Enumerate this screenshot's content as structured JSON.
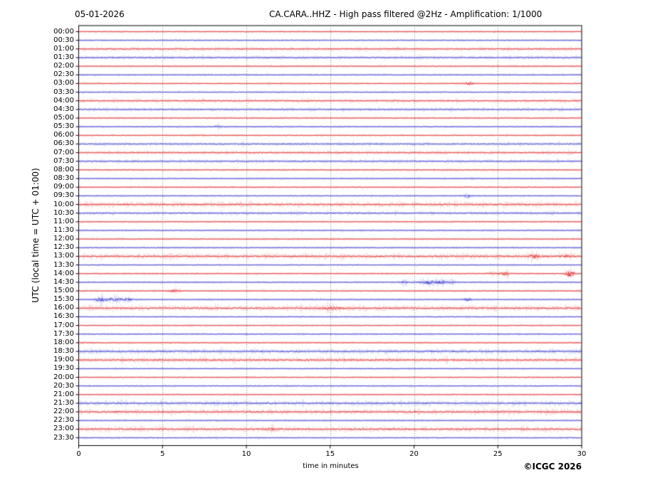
{
  "footer": {
    "copyright": "©ICGC 2026"
  },
  "colors": {
    "trace_red": "#e02222",
    "trace_blue": "#3333cc",
    "grid": "#555555",
    "frame": "#000000"
  },
  "chart_data": {
    "type": "line",
    "variant": "helicorder-seismogram",
    "date": "05-01-2026",
    "title": "CA.CARA..HHZ - High pass filtered @2Hz - Amplification: 1/1000",
    "xlabel": "time in minutes",
    "ylabel": "UTC (local time = UTC + 01:00)",
    "xlim": [
      0,
      30
    ],
    "x_ticks": [
      0,
      5,
      10,
      15,
      20,
      25,
      30
    ],
    "grid": "vertical-dotted-every-5-min",
    "row_minutes": 30,
    "row_color_rule": "rows starting at :00 are red, rows starting at :30 are blue",
    "rows": [
      {
        "label": "00:00",
        "color": "red",
        "noise": "low",
        "events": []
      },
      {
        "label": "00:30",
        "color": "blue",
        "noise": "low",
        "events": []
      },
      {
        "label": "01:00",
        "color": "red",
        "noise": "medium",
        "events": []
      },
      {
        "label": "01:30",
        "color": "blue",
        "noise": "medium",
        "events": []
      },
      {
        "label": "02:00",
        "color": "red",
        "noise": "low",
        "events": []
      },
      {
        "label": "02:30",
        "color": "blue",
        "noise": "low",
        "events": []
      },
      {
        "label": "03:00",
        "color": "red",
        "noise": "low",
        "events": [
          {
            "t": 23.3,
            "amp": 2.0,
            "sigma": 0.18
          }
        ]
      },
      {
        "label": "03:30",
        "color": "blue",
        "noise": "low",
        "events": []
      },
      {
        "label": "04:00",
        "color": "red",
        "noise": "medium",
        "events": []
      },
      {
        "label": "04:30",
        "color": "blue",
        "noise": "medium",
        "events": []
      },
      {
        "label": "05:00",
        "color": "red",
        "noise": "low",
        "events": []
      },
      {
        "label": "05:30",
        "color": "blue",
        "noise": "low",
        "events": [
          {
            "t": 8.3,
            "amp": 1.2,
            "sigma": 0.2
          }
        ]
      },
      {
        "label": "06:00",
        "color": "red",
        "noise": "low",
        "events": []
      },
      {
        "label": "06:30",
        "color": "blue",
        "noise": "medium",
        "events": []
      },
      {
        "label": "07:00",
        "color": "red",
        "noise": "medium",
        "events": []
      },
      {
        "label": "07:30",
        "color": "blue",
        "noise": "medium",
        "events": []
      },
      {
        "label": "08:00",
        "color": "red",
        "noise": "low",
        "events": []
      },
      {
        "label": "08:30",
        "color": "blue",
        "noise": "low",
        "events": []
      },
      {
        "label": "09:00",
        "color": "red",
        "noise": "low",
        "events": []
      },
      {
        "label": "09:30",
        "color": "blue",
        "noise": "low",
        "events": [
          {
            "t": 23.2,
            "amp": 2.4,
            "sigma": 0.12
          }
        ]
      },
      {
        "label": "10:00",
        "color": "red",
        "noise": "high",
        "events": []
      },
      {
        "label": "10:30",
        "color": "blue",
        "noise": "medium",
        "events": []
      },
      {
        "label": "11:00",
        "color": "red",
        "noise": "low",
        "events": []
      },
      {
        "label": "11:30",
        "color": "blue",
        "noise": "low",
        "events": []
      },
      {
        "label": "12:00",
        "color": "red",
        "noise": "low",
        "events": []
      },
      {
        "label": "12:30",
        "color": "blue",
        "noise": "low",
        "events": []
      },
      {
        "label": "13:00",
        "color": "red",
        "noise": "high",
        "events": [
          {
            "t": 27.2,
            "amp": 2.0,
            "sigma": 0.25
          },
          {
            "t": 29.1,
            "amp": 1.2,
            "sigma": 0.2
          }
        ]
      },
      {
        "label": "13:30",
        "color": "blue",
        "noise": "low",
        "events": []
      },
      {
        "label": "14:00",
        "color": "red",
        "noise": "low",
        "events": [
          {
            "t": 24.9,
            "amp": 1.3,
            "sigma": 0.4
          },
          {
            "t": 25.5,
            "amp": 1.8,
            "sigma": 0.15
          },
          {
            "t": 29.3,
            "amp": 4.5,
            "sigma": 0.18
          }
        ]
      },
      {
        "label": "14:30",
        "color": "blue",
        "noise": "low",
        "events": [
          {
            "t": 19.4,
            "amp": 1.6,
            "sigma": 0.15
          },
          {
            "t": 20.9,
            "amp": 2.4,
            "sigma": 0.4
          },
          {
            "t": 21.7,
            "amp": 2.2,
            "sigma": 0.25
          },
          {
            "t": 22.3,
            "amp": 1.4,
            "sigma": 0.12
          }
        ]
      },
      {
        "label": "15:00",
        "color": "red",
        "noise": "low",
        "events": [
          {
            "t": 5.7,
            "amp": 1.8,
            "sigma": 0.25
          }
        ]
      },
      {
        "label": "15:30",
        "color": "blue",
        "noise": "low",
        "events": [
          {
            "t": 1.3,
            "amp": 2.4,
            "sigma": 0.25
          },
          {
            "t": 2.2,
            "amp": 2.4,
            "sigma": 0.45
          },
          {
            "t": 3.0,
            "amp": 1.6,
            "sigma": 0.15
          },
          {
            "t": 23.2,
            "amp": 2.0,
            "sigma": 0.15
          }
        ]
      },
      {
        "label": "16:00",
        "color": "red",
        "noise": "high",
        "events": [
          {
            "t": 15.1,
            "amp": 1.6,
            "sigma": 0.4
          }
        ]
      },
      {
        "label": "16:30",
        "color": "blue",
        "noise": "low",
        "events": []
      },
      {
        "label": "17:00",
        "color": "red",
        "noise": "low",
        "events": []
      },
      {
        "label": "17:30",
        "color": "blue",
        "noise": "low",
        "events": []
      },
      {
        "label": "18:00",
        "color": "red",
        "noise": "low",
        "events": []
      },
      {
        "label": "18:30",
        "color": "blue",
        "noise": "high",
        "events": []
      },
      {
        "label": "19:00",
        "color": "red",
        "noise": "high",
        "events": []
      },
      {
        "label": "19:30",
        "color": "blue",
        "noise": "low",
        "events": []
      },
      {
        "label": "20:00",
        "color": "red",
        "noise": "low",
        "events": []
      },
      {
        "label": "20:30",
        "color": "blue",
        "noise": "low",
        "events": []
      },
      {
        "label": "21:00",
        "color": "red",
        "noise": "low",
        "events": []
      },
      {
        "label": "21:30",
        "color": "blue",
        "noise": "high",
        "events": []
      },
      {
        "label": "22:00",
        "color": "red",
        "noise": "high",
        "events": []
      },
      {
        "label": "22:30",
        "color": "blue",
        "noise": "low",
        "events": []
      },
      {
        "label": "23:00",
        "color": "red",
        "noise": "high",
        "events": [
          {
            "t": 11.5,
            "amp": 1.4,
            "sigma": 0.25
          }
        ]
      },
      {
        "label": "23:30",
        "color": "blue",
        "noise": "low",
        "events": []
      }
    ]
  }
}
